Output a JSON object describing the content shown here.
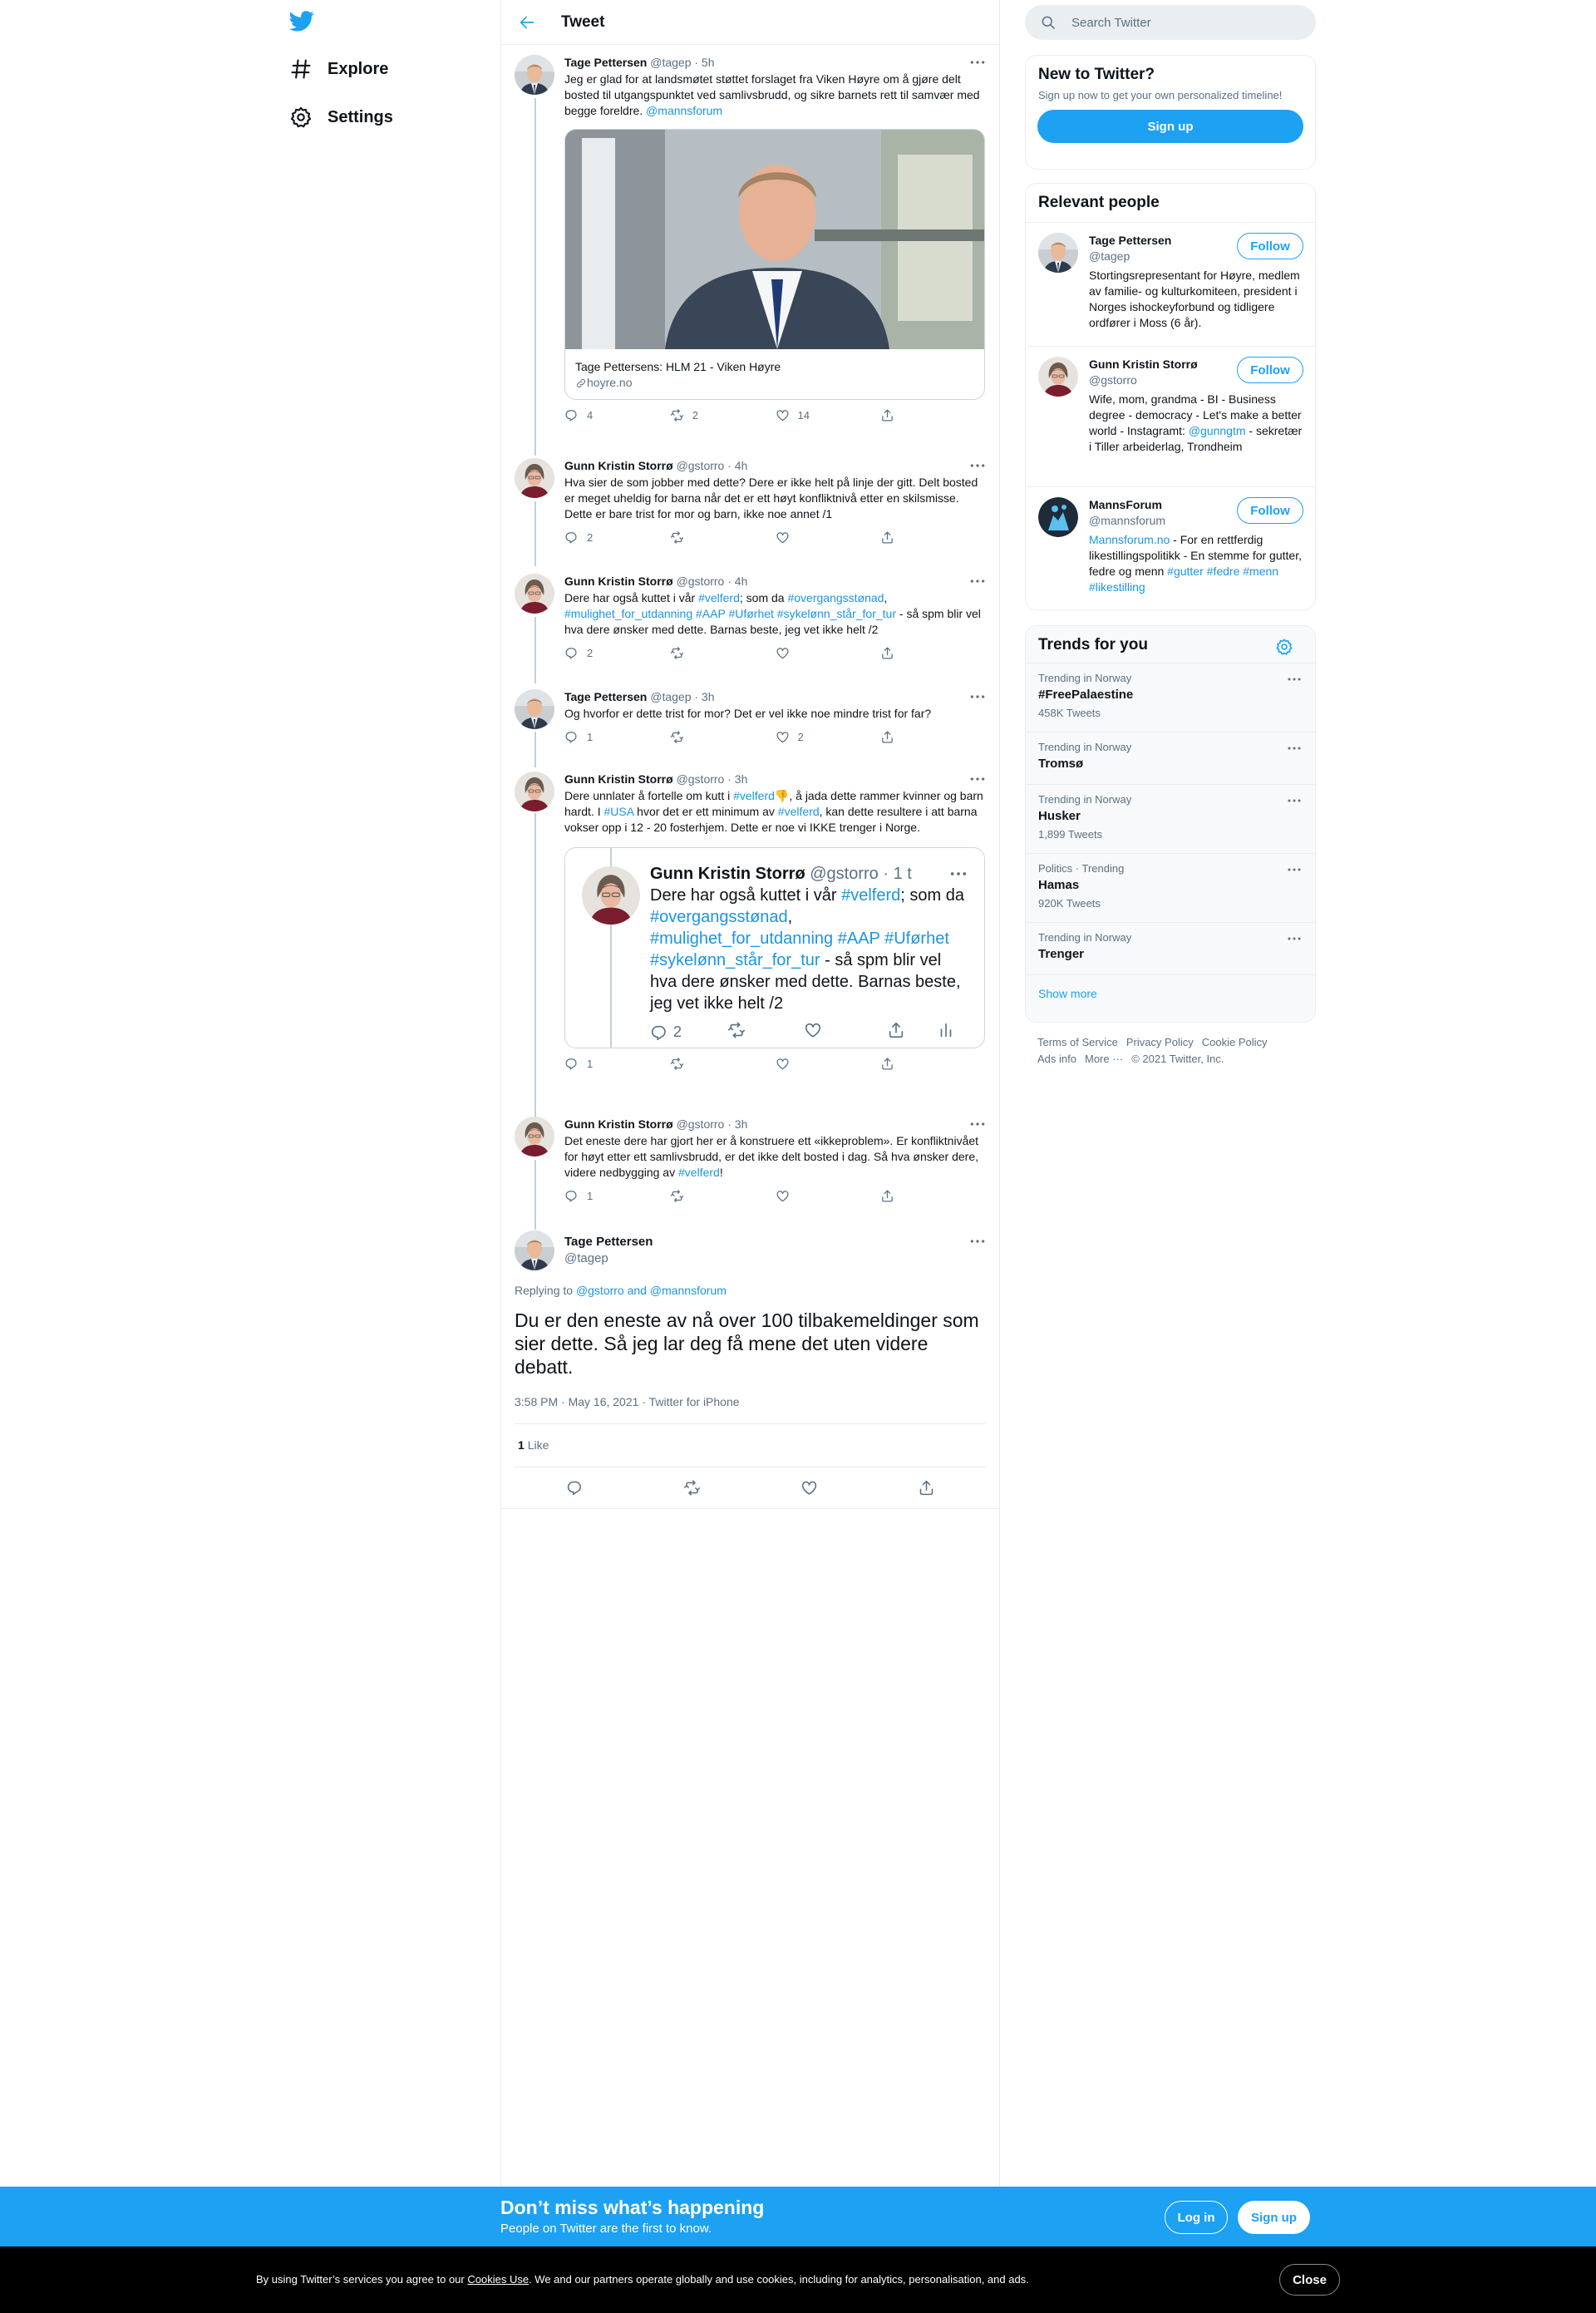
{
  "nav": {
    "items": [
      {
        "label": "Explore",
        "icon": "hashtag-icon"
      },
      {
        "label": "Settings",
        "icon": "gear-icon"
      }
    ]
  },
  "header": {
    "title": "Tweet"
  },
  "thread": [
    {
      "name": "Tage Pettersen",
      "handle": "@tagep",
      "time": "· 5h",
      "text_parts": [
        "Jeg er glad for at landsmøtet støttet forslaget fra Viken Høyre om å gjøre delt bosted til utgangspunktet ved samlivsbrudd, og sikre barnets rett til samvær med begge foreldre. ",
        "@mannsforum"
      ],
      "card": {
        "title": "Tage Pettersens: HLM 21 - Viken Høyre",
        "domain": "hoyre.no"
      },
      "replies": "4",
      "retweets": "2",
      "likes": "14"
    },
    {
      "name": "Gunn Kristin Storrø",
      "handle": "@gstorro",
      "time": "· 4h",
      "text": "Hva sier de som jobber med dette? Dere er ikke helt på linje der gitt. Delt bosted er meget uheldig for barna når det er ett høyt konfliktnivå etter en skilsmisse. Dette er bare trist for mor og barn, ikke noe annet /1",
      "replies": "2",
      "retweets": "",
      "likes": ""
    },
    {
      "name": "Gunn Kristin Storrø",
      "handle": "@gstorro",
      "time": "· 4h",
      "text_parts": [
        "Dere har også kuttet i vår ",
        "#velferd",
        "; som da ",
        "#overgangsstønad",
        ", ",
        "#mulighet_for_utdanning",
        " ",
        "#AAP",
        " ",
        "#Uførhet",
        " ",
        "#sykelønn_står_for_tur",
        " - så spm blir vel hva dere ønsker med dette. Barnas beste, jeg vet ikke helt /2"
      ],
      "replies": "2",
      "retweets": "",
      "likes": ""
    },
    {
      "name": "Tage Pettersen",
      "handle": "@tagep",
      "time": "· 3h",
      "text": "Og hvorfor er dette trist for mor? Det er vel ikke noe mindre trist for far?",
      "replies": "1",
      "retweets": "",
      "likes": "2"
    },
    {
      "name": "Gunn Kristin Storrø",
      "handle": "@gstorro",
      "time": "· 3h",
      "text_parts": [
        "Dere unnlater å fortelle om kutt i ",
        "#velferd",
        "👎",
        ", å jada dette rammer kvinner og barn hardt. I ",
        "#USA",
        " hvor det er ett minimum av ",
        "#velferd",
        ", kan dette resultere i att barna vokser opp i 12 - 20 fosterhjem. Dette er noe vi IKKE trenger i Norge."
      ],
      "quote": {
        "name": "Gunn Kristin Storrø",
        "handle": "@gstorro",
        "time": "· 1 t",
        "text_parts": [
          "Dere har også kuttet i vår ",
          "#velferd",
          "; som da ",
          "#overgangsstønad",
          ", ",
          "#mulighet_for_utdanning",
          " ",
          "#AAP",
          " ",
          "#Uførhet",
          " ",
          "#sykelønn_står_for_tur",
          " - så spm blir vel hva dere ønsker med dette. Barnas beste, jeg vet ikke helt /2"
        ],
        "replies": "2"
      },
      "replies": "1",
      "retweets": "",
      "likes": ""
    },
    {
      "name": "Gunn Kristin Storrø",
      "handle": "@gstorro",
      "time": "· 3h",
      "text_parts": [
        "Det eneste dere har gjort her er å konstruere ett «ikkeproblem». Er konfliktnivået for høyt etter ett samlivsbrudd, er det ikke delt bosted i dag. Så hva ønsker dere, videre nedbygging av ",
        "#velferd",
        "!"
      ],
      "replies": "1",
      "retweets": "",
      "likes": ""
    }
  ],
  "focus": {
    "name": "Tage Pettersen",
    "handle": "@tagep",
    "replying_prefix": "Replying to ",
    "replying_to": "@gstorro and @mannsforum",
    "text": "Du er den eneste av nå over 100 tilbakemeldinger som sier dette. Så jeg lar deg få mene det uten videre debatt.",
    "meta": "3:58 PM · May 16, 2021 · Twitter for iPhone",
    "likes_count": "1",
    "likes_label": "Like"
  },
  "search": {
    "placeholder": "Search Twitter"
  },
  "new_to_twitter": {
    "title": "New to Twitter?",
    "subtitle": "Sign up now to get your own personalized timeline!",
    "button": "Sign up"
  },
  "relevant": {
    "title": "Relevant people",
    "follow_label": "Follow",
    "people": [
      {
        "name": "Tage Pettersen",
        "handle": "@tagep",
        "bio_parts": [
          "Stortingsrepresentant for Høyre, medlem av familie- og kulturkomiteen, president i Norges ishockeyforbund og tidligere ordfører i Moss (6 år)."
        ]
      },
      {
        "name": "Gunn Kristin Storrø",
        "handle": "@gstorro",
        "bio_parts": [
          "Wife, mom, grandma - BI - Business degree - democracy - Let's make a better world - Instagramt: ",
          "@gunngtm",
          " - sekretær i Tiller arbeiderlag, Trondheim"
        ]
      },
      {
        "name": "MannsForum",
        "handle": "@mannsforum",
        "bio_parts": [
          "Mannsforum.no",
          " - For en rettferdig likestillingspolitikk - En stemme for gutter, fedre og menn ",
          "#gutter",
          " ",
          "#fedre",
          " ",
          "#menn",
          " ",
          "#likestilling"
        ]
      }
    ]
  },
  "trends": {
    "title": "Trends for you",
    "items": [
      {
        "context": "Trending in Norway",
        "name": "#FreePalaestine",
        "count": "458K Tweets"
      },
      {
        "context": "Trending in Norway",
        "name": "Tromsø",
        "count": ""
      },
      {
        "context": "Trending in Norway",
        "name": "Husker",
        "count": "1,899 Tweets"
      },
      {
        "context": "Politics · Trending",
        "name": "Hamas",
        "count": "920K Tweets"
      },
      {
        "context": "Trending in Norway",
        "name": "Trenger",
        "count": ""
      }
    ],
    "show_more": "Show more"
  },
  "footer": {
    "links": [
      "Terms of Service",
      "Privacy Policy",
      "Cookie Policy",
      "Ads info",
      "More ···"
    ],
    "copyright": "© 2021 Twitter, Inc."
  },
  "bottom_bar": {
    "title": "Don’t miss what’s happening",
    "subtitle": "People on Twitter are the first to know.",
    "login": "Log in",
    "signup": "Sign up"
  },
  "cookie": {
    "text_before": "By using Twitter’s services you agree to our ",
    "link": "Cookies Use",
    "text_after": ". We and our partners operate globally and use cookies, including for analytics, personalisation, and ads.",
    "close": "Close"
  },
  "colors": {
    "accent": "#1da1f2",
    "link": "#1b95e0",
    "text": "#0f1419",
    "secondary": "#5b7083"
  }
}
